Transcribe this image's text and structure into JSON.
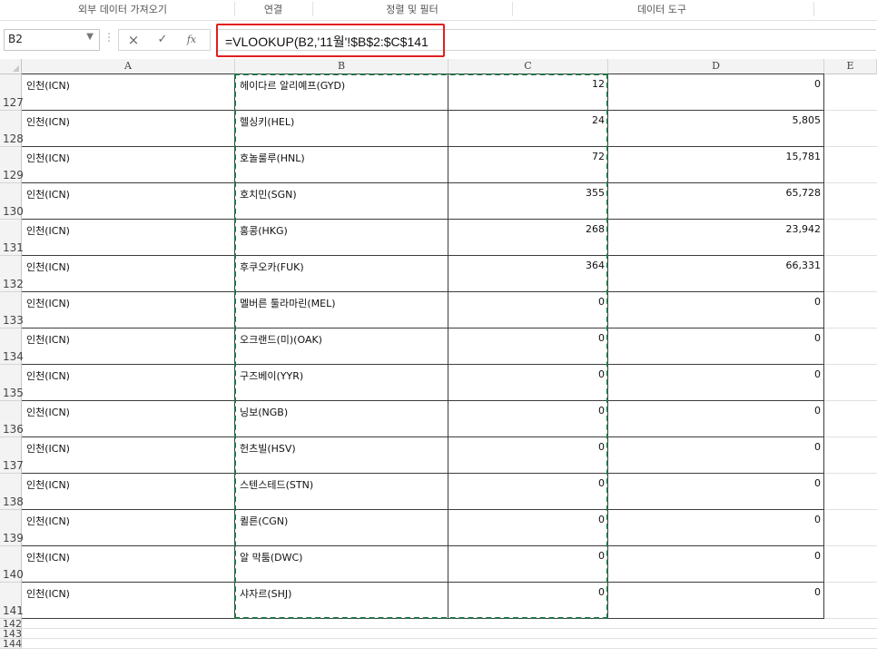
{
  "ribbon": {
    "groups": [
      "외부 데이터 가져오기",
      "연결",
      "정렬 및 필터",
      "데이터 도구"
    ]
  },
  "formula_bar": {
    "name_box": "B2",
    "cancel_icon": "×",
    "enter_icon": "✓",
    "fx_icon": "fx",
    "formula": "=VLOOKUP(B2,'11월'!$B$2:$C$141"
  },
  "columns": [
    "A",
    "B",
    "C",
    "D",
    "E"
  ],
  "rows": [
    {
      "num": "127",
      "a": "인천(ICN)",
      "b": "헤이다르 알리예프(GYD)",
      "c": "12",
      "d": "0"
    },
    {
      "num": "128",
      "a": "인천(ICN)",
      "b": "헬싱키(HEL)",
      "c": "24",
      "d": "5,805"
    },
    {
      "num": "129",
      "a": "인천(ICN)",
      "b": "호놀룰루(HNL)",
      "c": "72",
      "d": "15,781"
    },
    {
      "num": "130",
      "a": "인천(ICN)",
      "b": "호치민(SGN)",
      "c": "355",
      "d": "65,728"
    },
    {
      "num": "131",
      "a": "인천(ICN)",
      "b": "홍콩(HKG)",
      "c": "268",
      "d": "23,942"
    },
    {
      "num": "132",
      "a": "인천(ICN)",
      "b": "후쿠오카(FUK)",
      "c": "364",
      "d": "66,331"
    },
    {
      "num": "133",
      "a": "인천(ICN)",
      "b": "멜버른 툴라마린(MEL)",
      "c": "0",
      "d": "0"
    },
    {
      "num": "134",
      "a": "인천(ICN)",
      "b": "오크랜드(미)(OAK)",
      "c": "0",
      "d": "0"
    },
    {
      "num": "135",
      "a": "인천(ICN)",
      "b": "구즈베이(YYR)",
      "c": "0",
      "d": "0"
    },
    {
      "num": "136",
      "a": "인천(ICN)",
      "b": "닝보(NGB)",
      "c": "0",
      "d": "0"
    },
    {
      "num": "137",
      "a": "인천(ICN)",
      "b": "헌츠빌(HSV)",
      "c": "0",
      "d": "0"
    },
    {
      "num": "138",
      "a": "인천(ICN)",
      "b": "스텐스테드(STN)",
      "c": "0",
      "d": "0"
    },
    {
      "num": "139",
      "a": "인천(ICN)",
      "b": "퀼른(CGN)",
      "c": "0",
      "d": "0"
    },
    {
      "num": "140",
      "a": "인천(ICN)",
      "b": "알 막툼(DWC)",
      "c": "0",
      "d": "0"
    },
    {
      "num": "141",
      "a": "인천(ICN)",
      "b": "샤자르(SHJ)",
      "c": "0",
      "d": "0"
    }
  ],
  "empty_rows": [
    "142",
    "143",
    "144"
  ],
  "colors": {
    "selection_marquee": "#217346",
    "highlight_box": "#e21f1f"
  }
}
